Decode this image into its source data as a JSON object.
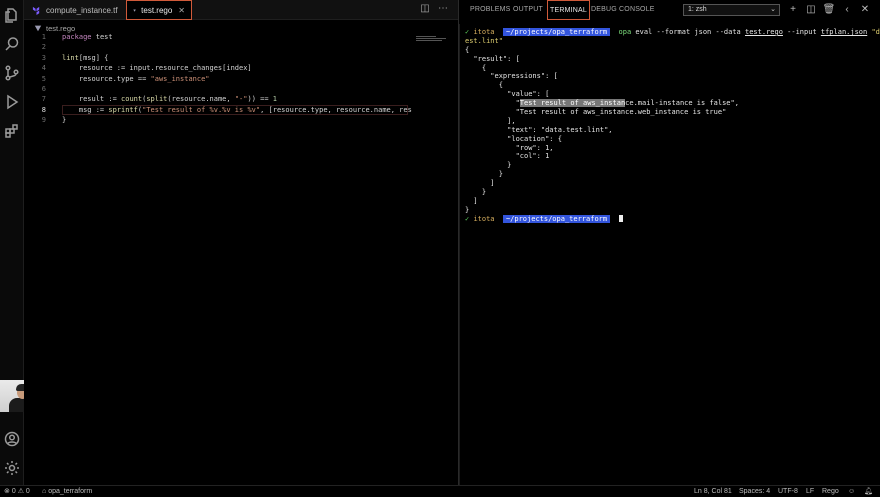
{
  "editor": {
    "tabs": [
      {
        "label": "compute_instance.tf",
        "active": false
      },
      {
        "label": "test.rego",
        "active": true
      }
    ],
    "breadcrumb": "test.rego",
    "lines": [
      {
        "n": "1",
        "html": "<span class=\"kw\">package</span> test"
      },
      {
        "n": "2",
        "html": ""
      },
      {
        "n": "3",
        "html": "<span class=\"fn\">lint</span>[msg] {"
      },
      {
        "n": "4",
        "html": "    resource := input.resource_changes[index]"
      },
      {
        "n": "5",
        "html": "    resource.type == <span class=\"str\">\"aws_instance\"</span>"
      },
      {
        "n": "6",
        "html": ""
      },
      {
        "n": "7",
        "html": "    result := <span class=\"fn\">count</span>(<span class=\"fn\">split</span>(resource.name, <span class=\"str\">\"-\"</span>)) == <span class=\"num\">1</span>"
      },
      {
        "n": "8",
        "html": "    msg := <span class=\"fn\">sprintf</span>(<span class=\"str\">\"Test result of %v.%v is %v\"</span>, [resource.type, resource.name, res"
      },
      {
        "n": "9",
        "html": "}"
      }
    ],
    "current_line": "8"
  },
  "panel": {
    "tabs": [
      "PROBLEMS",
      "OUTPUT",
      "TERMINAL",
      "DEBUG CONSOLE"
    ],
    "active_tab": "TERMINAL",
    "terminal_select": "1: zsh",
    "terminal_lines": [
      "<span class=\"prompt-ok\">✓</span> <span class=\"prompt-user\">itota</span>  <span class=\"prompt-path\">~/projects/opa_terraform</span>  <span class=\"cmd-cmd\">opa</span> eval --format json --data <span class=\"uline\">test.rego</span> --input <span class=\"uline\">tfplan.json</span> <span class=\"cmd-str\">\"data.t</span>",
      "<span class=\"cmd-str\">est.lint\"</span>",
      "{",
      "  \"result\": [",
      "    {",
      "      \"expressions\": [",
      "        {",
      "          \"value\": [",
      "            \"<span class=\"sel\">Test result of aws_instan</span>ce.mail-instance is false\",",
      "            \"Test result of aws_instance.web_instance is true\"",
      "          ],",
      "          \"text\": \"data.test.lint\",",
      "          \"location\": {",
      "            \"row\": 1,",
      "            \"col\": 1",
      "          }",
      "        }",
      "      ]",
      "    }",
      "  ]",
      "}",
      "<span class=\"prompt-ok\">✓</span> <span class=\"prompt-user\">itota</span>  <span class=\"prompt-path\">~/projects/opa_terraform</span>  <span class=\"cursor\"></span>"
    ]
  },
  "status": {
    "errors": "0",
    "warnings": "0",
    "folder": "opa_terraform",
    "position": "Ln 8, Col 81",
    "spaces": "Spaces: 4",
    "encoding": "UTF-8",
    "eol": "LF",
    "language": "Rego"
  },
  "colors": {
    "accent_border": "#d05a3a",
    "prompt_path_bg": "#3355dd"
  }
}
